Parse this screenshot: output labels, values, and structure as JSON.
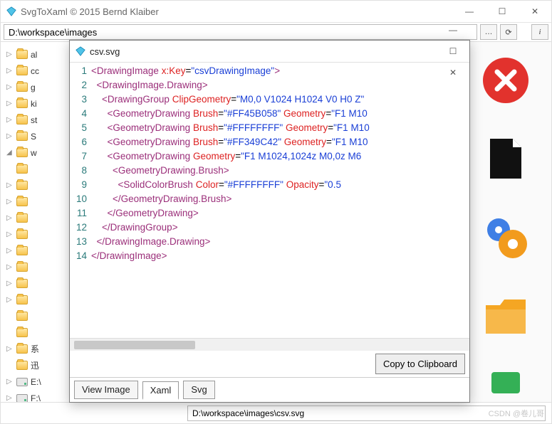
{
  "window": {
    "title": "SvgToXaml   © 2015 Bernd Klaiber",
    "path": "D:\\workspace\\images",
    "info_btn": "i"
  },
  "tree": {
    "items": [
      {
        "exp": "▷",
        "type": "fold",
        "label": "al"
      },
      {
        "exp": "▷",
        "type": "fold",
        "label": "cc"
      },
      {
        "exp": "▷",
        "type": "fold",
        "label": "g"
      },
      {
        "exp": "▷",
        "type": "fold",
        "label": "ki"
      },
      {
        "exp": "▷",
        "type": "fold",
        "label": "st"
      },
      {
        "exp": "▷",
        "type": "fold",
        "label": "S"
      },
      {
        "exp": "◢",
        "type": "fold",
        "label": "w"
      },
      {
        "exp": "",
        "type": "fold",
        "label": ""
      },
      {
        "exp": "▷",
        "type": "fold",
        "label": ""
      },
      {
        "exp": "▷",
        "type": "fold",
        "label": ""
      },
      {
        "exp": "▷",
        "type": "fold",
        "label": ""
      },
      {
        "exp": "▷",
        "type": "fold",
        "label": ""
      },
      {
        "exp": "▷",
        "type": "fold",
        "label": ""
      },
      {
        "exp": "▷",
        "type": "fold",
        "label": ""
      },
      {
        "exp": "▷",
        "type": "fold",
        "label": ""
      },
      {
        "exp": "▷",
        "type": "fold",
        "label": ""
      },
      {
        "exp": "",
        "type": "fold",
        "label": ""
      },
      {
        "exp": "",
        "type": "fold",
        "label": ""
      },
      {
        "exp": "▷",
        "type": "fold",
        "label": "系"
      },
      {
        "exp": "",
        "type": "fold",
        "label": "迅"
      },
      {
        "exp": "▷",
        "type": "drive",
        "label": "E:\\"
      },
      {
        "exp": "▷",
        "type": "drive",
        "label": "F:\\"
      }
    ]
  },
  "footer": {
    "path": "D:\\workspace\\images\\csv.svg"
  },
  "modal": {
    "title": "csv.svg",
    "copy_btn": "Copy to Clipboard",
    "tabs": [
      "View Image",
      "Xaml",
      "Svg"
    ],
    "active_tab": 1,
    "lines": [
      {
        "n": "1",
        "h": "<span class='tag'>&lt;DrawingImage</span> <span class='attr'>x:Key</span>=<span class='str'>\"csvDrawingImage\"</span><span class='tag'>&gt;</span>"
      },
      {
        "n": "2",
        "h": "  <span class='tag'>&lt;DrawingImage.Drawing&gt;</span>"
      },
      {
        "n": "3",
        "h": "    <span class='tag'>&lt;DrawingGroup</span> <span class='attr'>ClipGeometry</span>=<span class='str'>\"M0,0 V1024 H1024 V0 H0 Z\"</span>"
      },
      {
        "n": "4",
        "h": "      <span class='tag'>&lt;GeometryDrawing</span> <span class='attr'>Brush</span>=<span class='str'>\"#FF45B058\"</span> <span class='attr'>Geometry</span>=<span class='str'>\"F1 M10</span>"
      },
      {
        "n": "5",
        "h": "      <span class='tag'>&lt;GeometryDrawing</span> <span class='attr'>Brush</span>=<span class='str'>\"#FFFFFFFF\"</span> <span class='attr'>Geometry</span>=<span class='str'>\"F1 M10</span>"
      },
      {
        "n": "6",
        "h": "      <span class='tag'>&lt;GeometryDrawing</span> <span class='attr'>Brush</span>=<span class='str'>\"#FF349C42\"</span> <span class='attr'>Geometry</span>=<span class='str'>\"F1 M10</span>"
      },
      {
        "n": "7",
        "h": "      <span class='tag'>&lt;GeometryDrawing</span> <span class='attr'>Geometry</span>=<span class='str'>\"F1 M1024,1024z M0,0z M6</span>"
      },
      {
        "n": "8",
        "h": "        <span class='tag'>&lt;GeometryDrawing.Brush&gt;</span>"
      },
      {
        "n": "9",
        "h": "          <span class='tag'>&lt;SolidColorBrush</span> <span class='attr'>Color</span>=<span class='str'>\"#FFFFFFFF\"</span> <span class='attr'>Opacity</span>=<span class='str'>\"0.5</span>"
      },
      {
        "n": "10",
        "h": "        <span class='tag'>&lt;/GeometryDrawing.Brush&gt;</span>"
      },
      {
        "n": "11",
        "h": "      <span class='tag'>&lt;/GeometryDrawing&gt;</span>"
      },
      {
        "n": "12",
        "h": "    <span class='tag'>&lt;/DrawingGroup&gt;</span>"
      },
      {
        "n": "13",
        "h": "  <span class='tag'>&lt;/DrawingImage.Drawing&gt;</span>"
      },
      {
        "n": "14",
        "h": "<span class='tag'>&lt;/DrawingImage&gt;</span>"
      }
    ]
  },
  "watermark": "CSDN @卷儿哥"
}
